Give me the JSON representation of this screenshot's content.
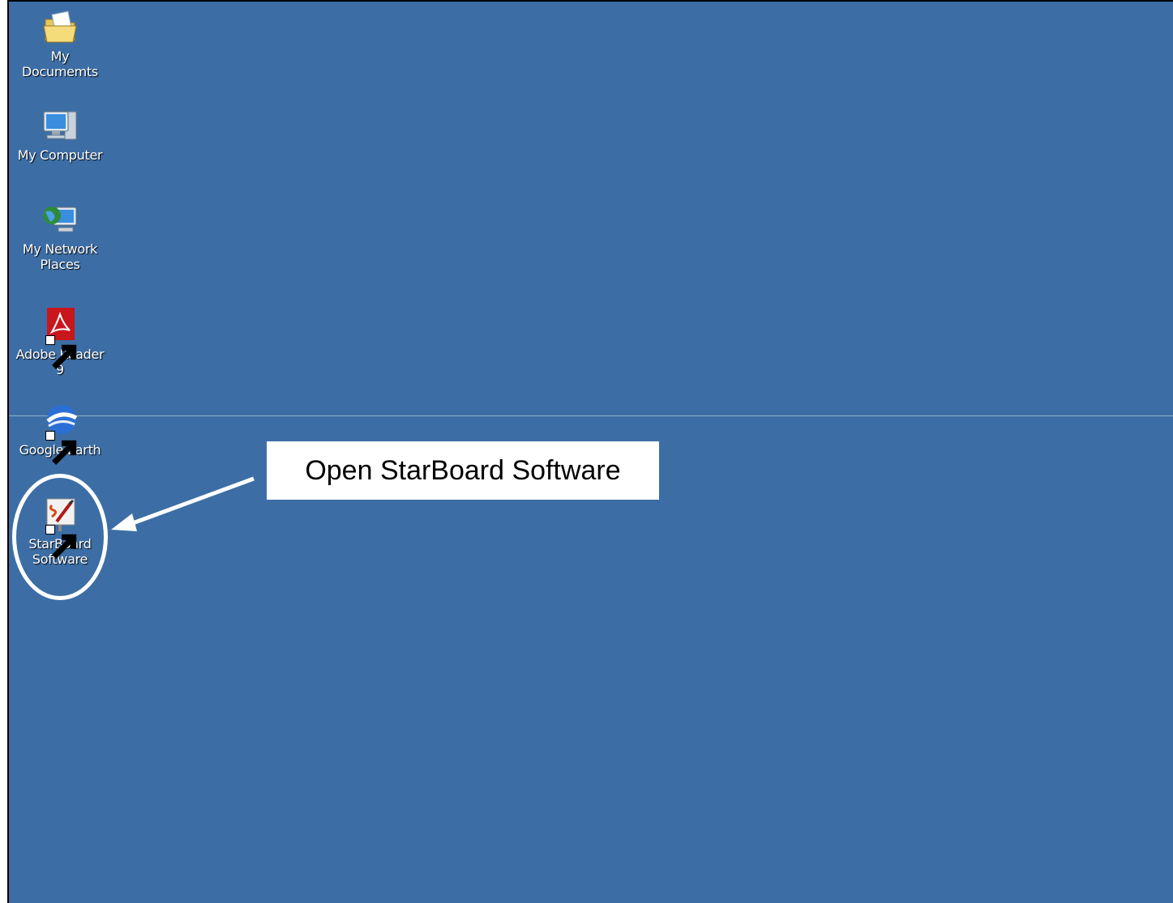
{
  "desktop": {
    "background_color": "#3C6EA5",
    "icons": [
      {
        "label": "My\nDocumemts",
        "icon": "folder-icon"
      },
      {
        "label": "My Computer",
        "icon": "computer-icon"
      },
      {
        "label": "My Network\nPlaces",
        "icon": "network-icon"
      },
      {
        "label": "Adobe Reader\n9",
        "icon": "adobe-reader-icon"
      },
      {
        "label": "Google Earth",
        "icon": "google-earth-icon"
      },
      {
        "label": "StarBoard\nSoftware",
        "icon": "starboard-icon"
      }
    ]
  },
  "annotation": {
    "callout_text": "Open StarBoard Software",
    "highlight_color": "#ffffff"
  }
}
